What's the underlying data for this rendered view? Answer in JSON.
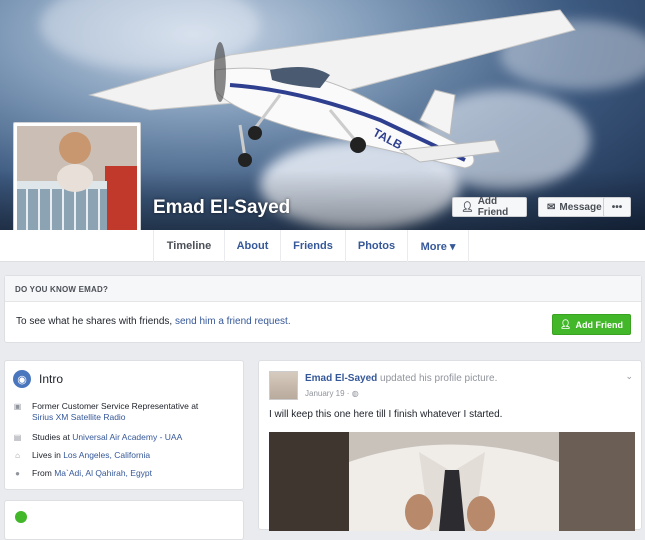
{
  "profile": {
    "name": "Emad El-Sayed",
    "cover_icon": "airplane-photo",
    "profile_pic_icon": "child-photo"
  },
  "cover_actions": {
    "add_friend": "Add Friend",
    "message": "Message",
    "more": "•••"
  },
  "nav": {
    "tabs": [
      {
        "label": "Timeline"
      },
      {
        "label": "About"
      },
      {
        "label": "Friends"
      },
      {
        "label": "Photos"
      },
      {
        "label": "More ▾"
      }
    ]
  },
  "know": {
    "heading": "DO YOU KNOW EMAD?",
    "text_before": "To see what he shares with friends,",
    "link": "send him a friend request.",
    "button": "Add Friend"
  },
  "intro": {
    "title": "Intro",
    "rows": [
      {
        "icon": "briefcase-icon",
        "text": "Former Customer Service Representative at",
        "link": "Sirius XM Satellite Radio"
      },
      {
        "icon": "graduation-cap-icon",
        "text": "Studies at",
        "link": "Universal Air Academy - UAA"
      },
      {
        "icon": "home-icon",
        "text": "Lives in",
        "link": "Los Angeles, California"
      },
      {
        "icon": "location-pin-icon",
        "text": "From",
        "link": "Ma`Adi, Al Qahirah, Egypt"
      }
    ]
  },
  "post": {
    "author": "Emad El-Sayed",
    "action": "updated his profile picture.",
    "date": "January 19 · ◍",
    "text": "I will keep this one here till I finish whatever I started."
  },
  "colors": {
    "link": "#365899",
    "green": "#42b72a",
    "background": "#e9ebee"
  }
}
